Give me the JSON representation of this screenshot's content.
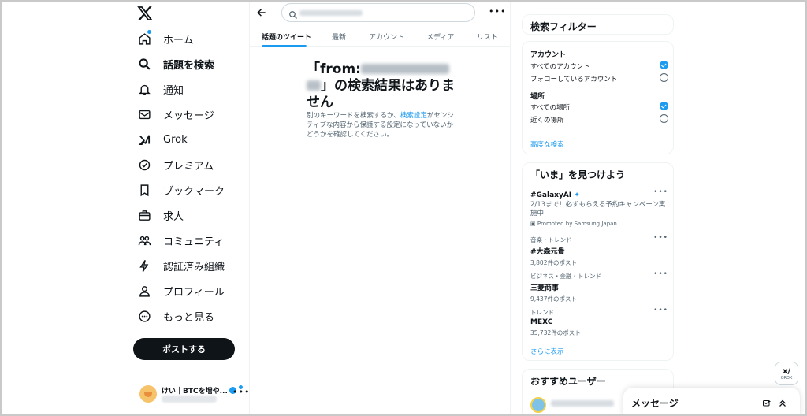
{
  "nav": {
    "items": [
      {
        "label": "ホーム",
        "icon": "home-icon"
      },
      {
        "label": "話題を検索",
        "icon": "search-icon"
      },
      {
        "label": "通知",
        "icon": "bell-icon"
      },
      {
        "label": "メッセージ",
        "icon": "mail-icon"
      },
      {
        "label": "Grok",
        "icon": "grok-icon"
      },
      {
        "label": "プレミアム",
        "icon": "premium-icon"
      },
      {
        "label": "ブックマーク",
        "icon": "bookmark-icon"
      },
      {
        "label": "求人",
        "icon": "briefcase-icon"
      },
      {
        "label": "コミュニティ",
        "icon": "community-icon"
      },
      {
        "label": "認証済み組織",
        "icon": "lightning-icon"
      },
      {
        "label": "プロフィール",
        "icon": "person-icon"
      },
      {
        "label": "もっと見る",
        "icon": "more-circle-icon"
      }
    ],
    "post_button": "ポストする",
    "account_name": "けい｜BTCを増や..."
  },
  "main": {
    "tabs": [
      {
        "label": "話題のツイート"
      },
      {
        "label": "最新"
      },
      {
        "label": "アカウント"
      },
      {
        "label": "メディア"
      },
      {
        "label": "リスト"
      }
    ],
    "result": {
      "title_prefix": "「from:",
      "title_suffix": "」の検索結果はありません",
      "sub_part1": "別のキーワードを検索するか、",
      "sub_link": "検索設定",
      "sub_part2": "がセンシティブな内容から保護する設定になっていないかどうかを確認してください。"
    }
  },
  "filters": {
    "title": "検索フィルター",
    "account_label": "アカウント",
    "account_opts": [
      "すべてのアカウント",
      "フォローしているアカウント"
    ],
    "account_selected": 0,
    "place_label": "場所",
    "place_opts": [
      "すべての場所",
      "近くの場所"
    ],
    "place_selected": 0,
    "advanced": "高度な検索"
  },
  "trends": {
    "title": "「いま」を見つけよう",
    "items": [
      {
        "meta": "",
        "title": "#GalaxyAI",
        "desc": "2/13まで！必ずもらえる予約キャンペーン実施中",
        "promo": "Promoted by Samsung Japan"
      },
      {
        "meta": "音楽・トレンド",
        "title": "#大森元貴",
        "count": "3,802件のポスト"
      },
      {
        "meta": "ビジネス・金融・トレンド",
        "title": "三菱商事",
        "count": "9,437件のポスト"
      },
      {
        "meta": "トレンド",
        "title": "MEXC",
        "count": "35,732件のポスト"
      }
    ],
    "show_more": "さらに表示"
  },
  "recommend": {
    "title": "おすすめユーザー"
  },
  "grok_button": {
    "label": "GROK"
  },
  "messages_drawer": {
    "title": "メッセージ"
  },
  "colors": {
    "accent": "#1d9bf0",
    "text": "#0f1419",
    "muted": "#536471",
    "border": "#eff3f4"
  }
}
